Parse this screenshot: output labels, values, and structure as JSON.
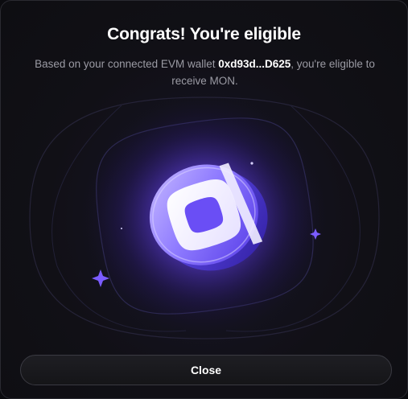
{
  "modal": {
    "title": "Congrats! You're eligible",
    "subtitle_prefix": "Based on your connected EVM wallet ",
    "wallet_address": "0xd93d...D625",
    "subtitle_suffix": ", you're eligible to receive MON."
  },
  "illustration": {
    "icon": "monad-coin-icon",
    "decorations": [
      "sparkle-icon",
      "sparkle-icon",
      "sparkle-icon"
    ],
    "accent_color": "#7b5cff",
    "glow_color": "#8a6bff"
  },
  "actions": {
    "close_label": "Close"
  },
  "colors": {
    "background": "#111016",
    "text_primary": "#ffffff",
    "text_secondary": "#9b9ba4",
    "button_border": "#3a3a42"
  }
}
